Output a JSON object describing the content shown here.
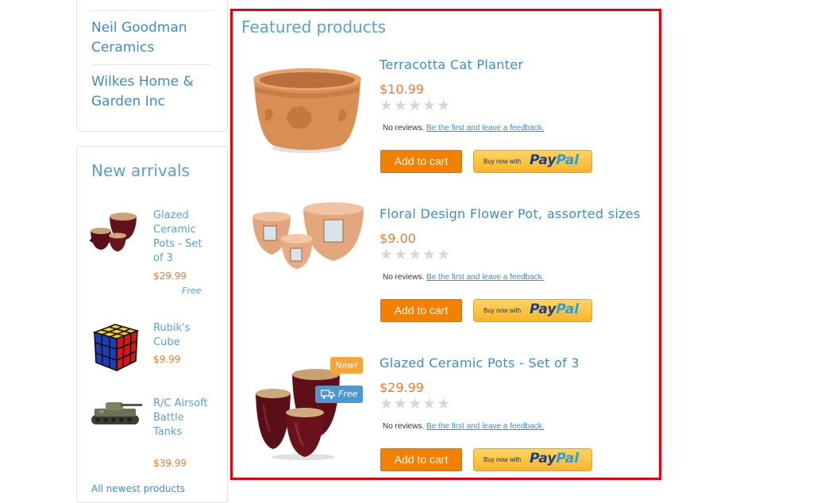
{
  "brands": {
    "items": [
      "Neil Goodman Ceramics",
      "Wilkes Home & Garden Inc"
    ]
  },
  "new_arrivals": {
    "title": "New arrivals",
    "items": [
      {
        "name": "Glazed Ceramic Pots - Set of 3",
        "price": "$29.99",
        "shipping": "Free"
      },
      {
        "name": "Rubik's Cube",
        "price": "$9.99"
      },
      {
        "name": "R/C Airsoft Battle Tanks",
        "price": "$39.99"
      }
    ],
    "all_link": "All newest products"
  },
  "featured": {
    "title": "Featured products",
    "products": [
      {
        "name": "Terracotta Cat Planter",
        "price": "$10.99",
        "stars": "★★★★★"
      },
      {
        "name": "Floral Design Flower Pot, assorted sizes",
        "price": "$9.00",
        "stars": "★★★★★"
      },
      {
        "name": "Glazed Ceramic Pots - Set of 3",
        "price": "$29.99",
        "stars": "★★★★★",
        "badge_new": "New!",
        "badge_free": "Free"
      }
    ],
    "reviews_text": "No reviews.",
    "feedback_link": "Be the first and leave a feedback.",
    "add_to_cart": "Add to cart",
    "paypal_small": "Buy now with",
    "paypal_logo_1": "Pay",
    "paypal_logo_2": "Pal"
  },
  "colors": {
    "link": "#3e8ccb",
    "price": "#f07a2d",
    "button": "#f28100",
    "highlight_border": "#e8000b"
  }
}
